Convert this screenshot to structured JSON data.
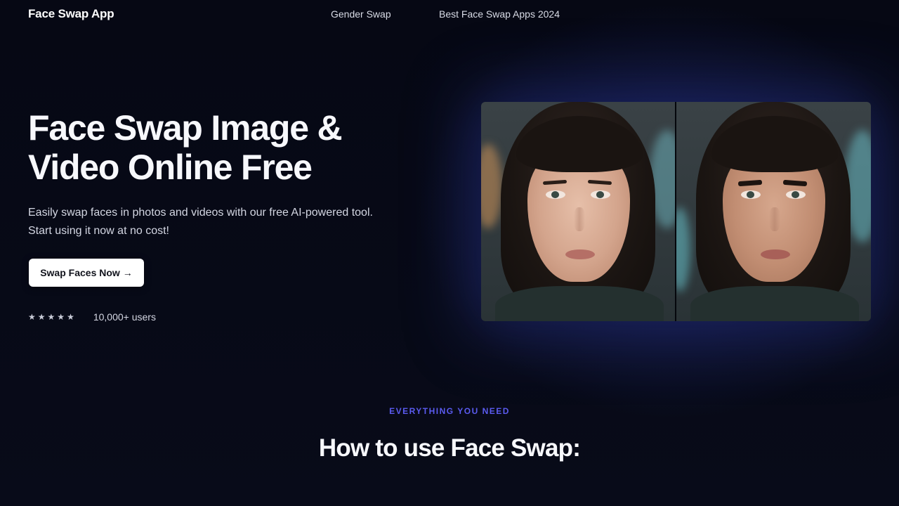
{
  "header": {
    "brand": "Face Swap App",
    "nav": [
      {
        "label": "Gender Swap"
      },
      {
        "label": "Best Face Swap Apps 2024"
      }
    ]
  },
  "hero": {
    "title_line1": "Face Swap Image &",
    "title_line2": "Video Online Free",
    "description_line1": "Easily swap faces in photos and videos with our free AI-powered tool.",
    "description_line2": "Start using it now at no cost!",
    "cta_label": "Swap Faces Now",
    "cta_icon": "→",
    "rating_stars": 5,
    "star_glyph": "★",
    "users_text": "10,000+ users"
  },
  "comparison": {
    "left_icon": "portrait-before-image",
    "right_icon": "portrait-after-image"
  },
  "section": {
    "eyebrow": "EVERYTHING YOU NEED",
    "title": "How to use Face Swap:"
  },
  "colors": {
    "background": "#070a16",
    "accent": "#5b5bf0",
    "cta_bg": "#ffffff"
  }
}
